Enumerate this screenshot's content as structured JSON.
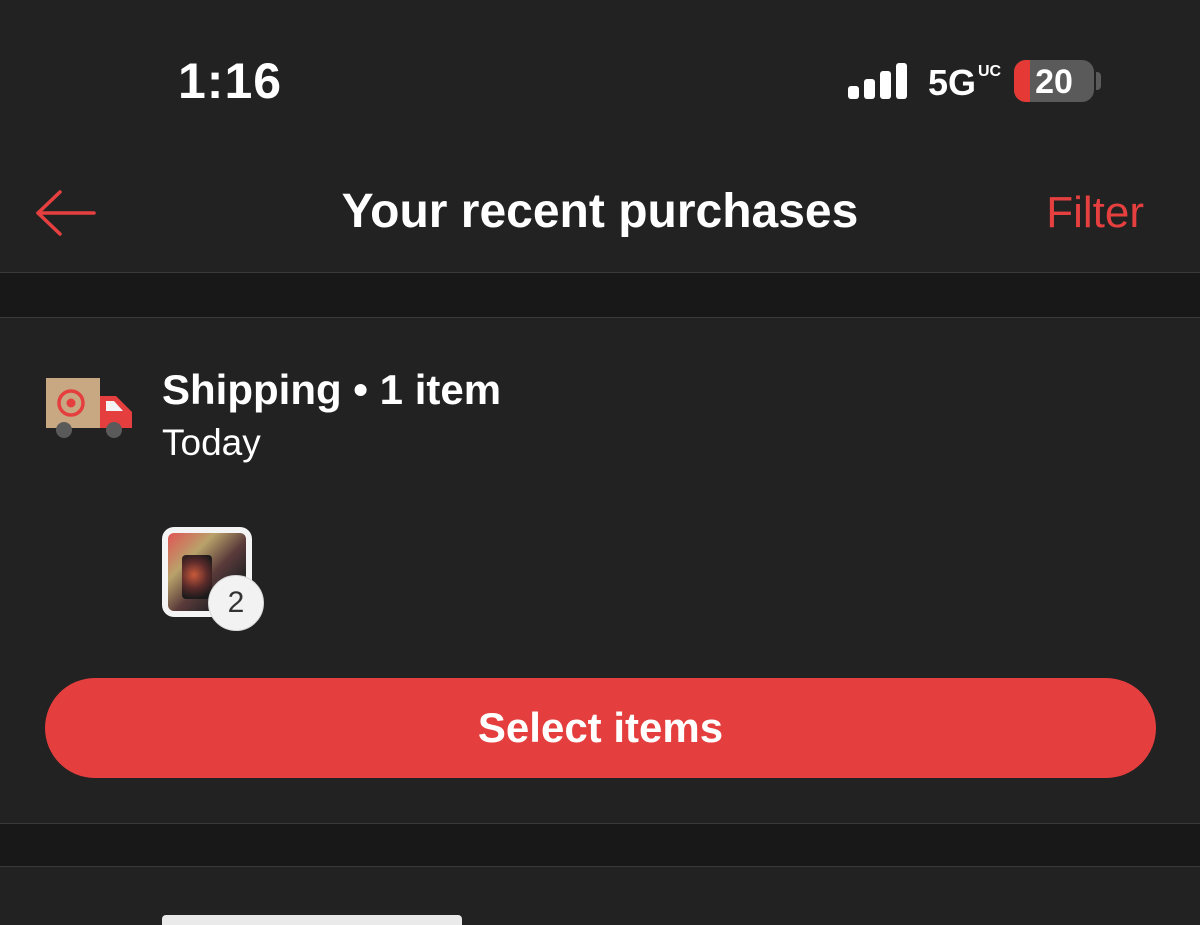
{
  "status_bar": {
    "time": "1:16",
    "network": "5G",
    "network_suffix": "UC",
    "battery_level": "20",
    "battery_fraction": 0.2
  },
  "nav": {
    "title": "Your recent purchases",
    "filter_label": "Filter",
    "back_icon": "arrow-left-icon"
  },
  "orders": [
    {
      "type_icon": "delivery-truck-icon",
      "title": "Shipping • 1 item",
      "date": "Today",
      "item_quantity": "2",
      "select_label": "Select items"
    }
  ],
  "colors": {
    "background": "#222222",
    "accent": "#e53e3e",
    "gap_band": "#181818",
    "text": "#ffffff"
  }
}
